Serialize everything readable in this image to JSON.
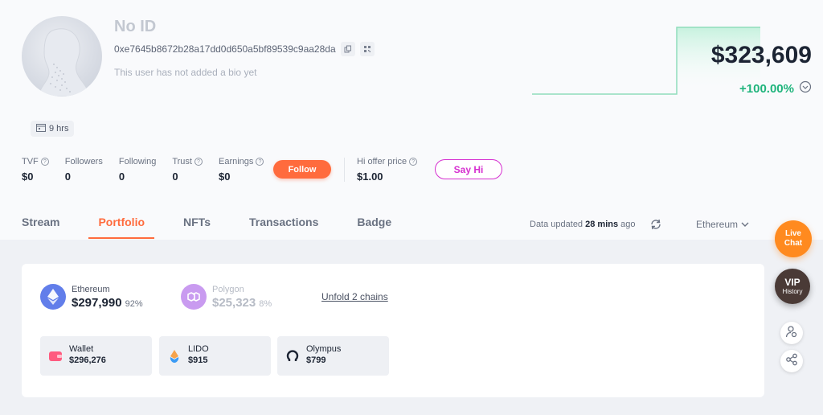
{
  "profile": {
    "name": "No ID",
    "address": "0xe7645b8672b28a17dd0d650a5bf89539c9aa28da",
    "bio": "This user has not added a bio yet",
    "badge": "9 hrs"
  },
  "portfolio_value": {
    "total": "$323,609",
    "change": "+100.00%"
  },
  "stats": [
    {
      "label": "TVF",
      "value": "$0"
    },
    {
      "label": "Followers",
      "value": "0"
    },
    {
      "label": "Following",
      "value": "0"
    },
    {
      "label": "Trust",
      "value": "0"
    },
    {
      "label": "Earnings",
      "value": "$0"
    }
  ],
  "follow_label": "Follow",
  "offer": {
    "label": "Hi offer price",
    "value": "$1.00"
  },
  "say_hi_label": "Say Hi",
  "tabs": [
    {
      "label": "Stream"
    },
    {
      "label": "Portfolio"
    },
    {
      "label": "NFTs"
    },
    {
      "label": "Transactions"
    },
    {
      "label": "Badge"
    }
  ],
  "active_tab": "Portfolio",
  "data_updated": {
    "prefix": "Data updated",
    "time": "28 mins",
    "suffix": "ago"
  },
  "chain_selector": "Ethereum",
  "chains": [
    {
      "name": "Ethereum",
      "value": "$297,990",
      "pct": "92%",
      "color": "#627eea"
    },
    {
      "name": "Polygon",
      "value": "$25,323",
      "pct": "8%",
      "color": "#c99bf0"
    }
  ],
  "unfold_label": "Unfold 2 chains",
  "protocols": [
    {
      "name": "Wallet",
      "value": "$296,276",
      "icon": "wallet-icon"
    },
    {
      "name": "LIDO",
      "value": "$915",
      "icon": "lido-icon"
    },
    {
      "name": "Olympus",
      "value": "$799",
      "icon": "olympus-icon"
    }
  ],
  "floating": {
    "live_line1": "Live",
    "live_line2": "Chat",
    "vip_line1": "VIP",
    "vip_line2": "History"
  },
  "colors": {
    "accent": "#ff6b3d",
    "positive": "#1fb47c",
    "say_hi": "#d62fd0"
  }
}
